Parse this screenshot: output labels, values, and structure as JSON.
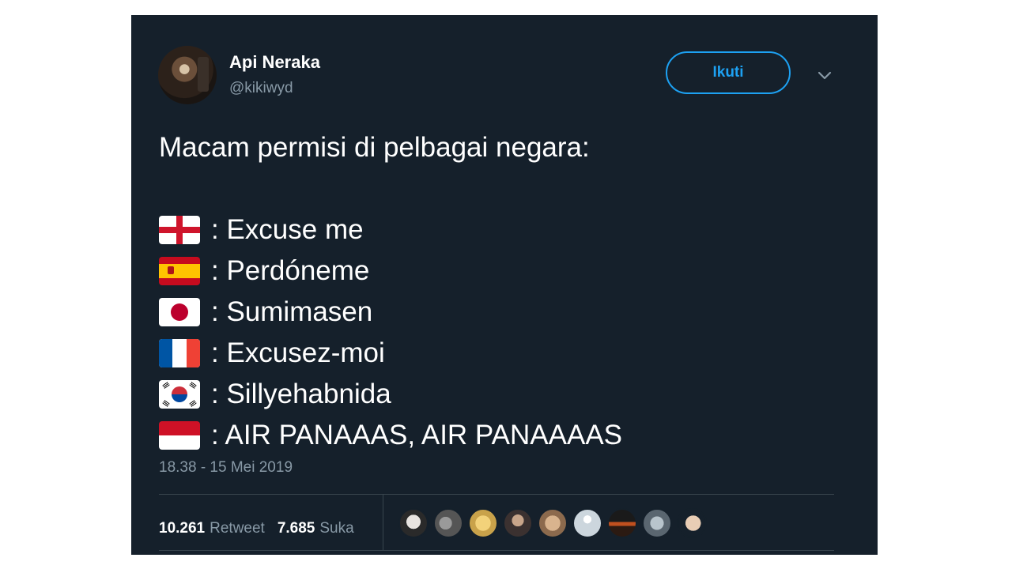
{
  "tweet": {
    "author_name": "Api Neraka",
    "author_handle": "@kikiwyd",
    "follow_label": "Ikuti",
    "text_intro": "Macam permisi di pelbagai negara:",
    "lines": [
      {
        "flag": "england-flag-icon",
        "text": ": Excuse me"
      },
      {
        "flag": "spain-flag-icon",
        "text": ": Perdóneme"
      },
      {
        "flag": "japan-flag-icon",
        "text": ": Sumimasen"
      },
      {
        "flag": "france-flag-icon",
        "text": ": Excusez-moi"
      },
      {
        "flag": "south-korea-flag-icon",
        "text": ": Sillyehabnida"
      },
      {
        "flag": "indonesia-flag-icon",
        "text": ": AIR PANAAAS, AIR PANAAAAS"
      }
    ],
    "timestamp": "18.38 - 15 Mei 2019",
    "retweet_count": "10.261",
    "retweet_label": "Retweet",
    "like_count": "7.685",
    "like_label": "Suka"
  },
  "colors": {
    "background": "#15202b",
    "accent": "#1da1f2",
    "muted_text": "#8899a6",
    "divider": "#38444d"
  },
  "icons": {
    "caret": "chevron-down-icon"
  }
}
